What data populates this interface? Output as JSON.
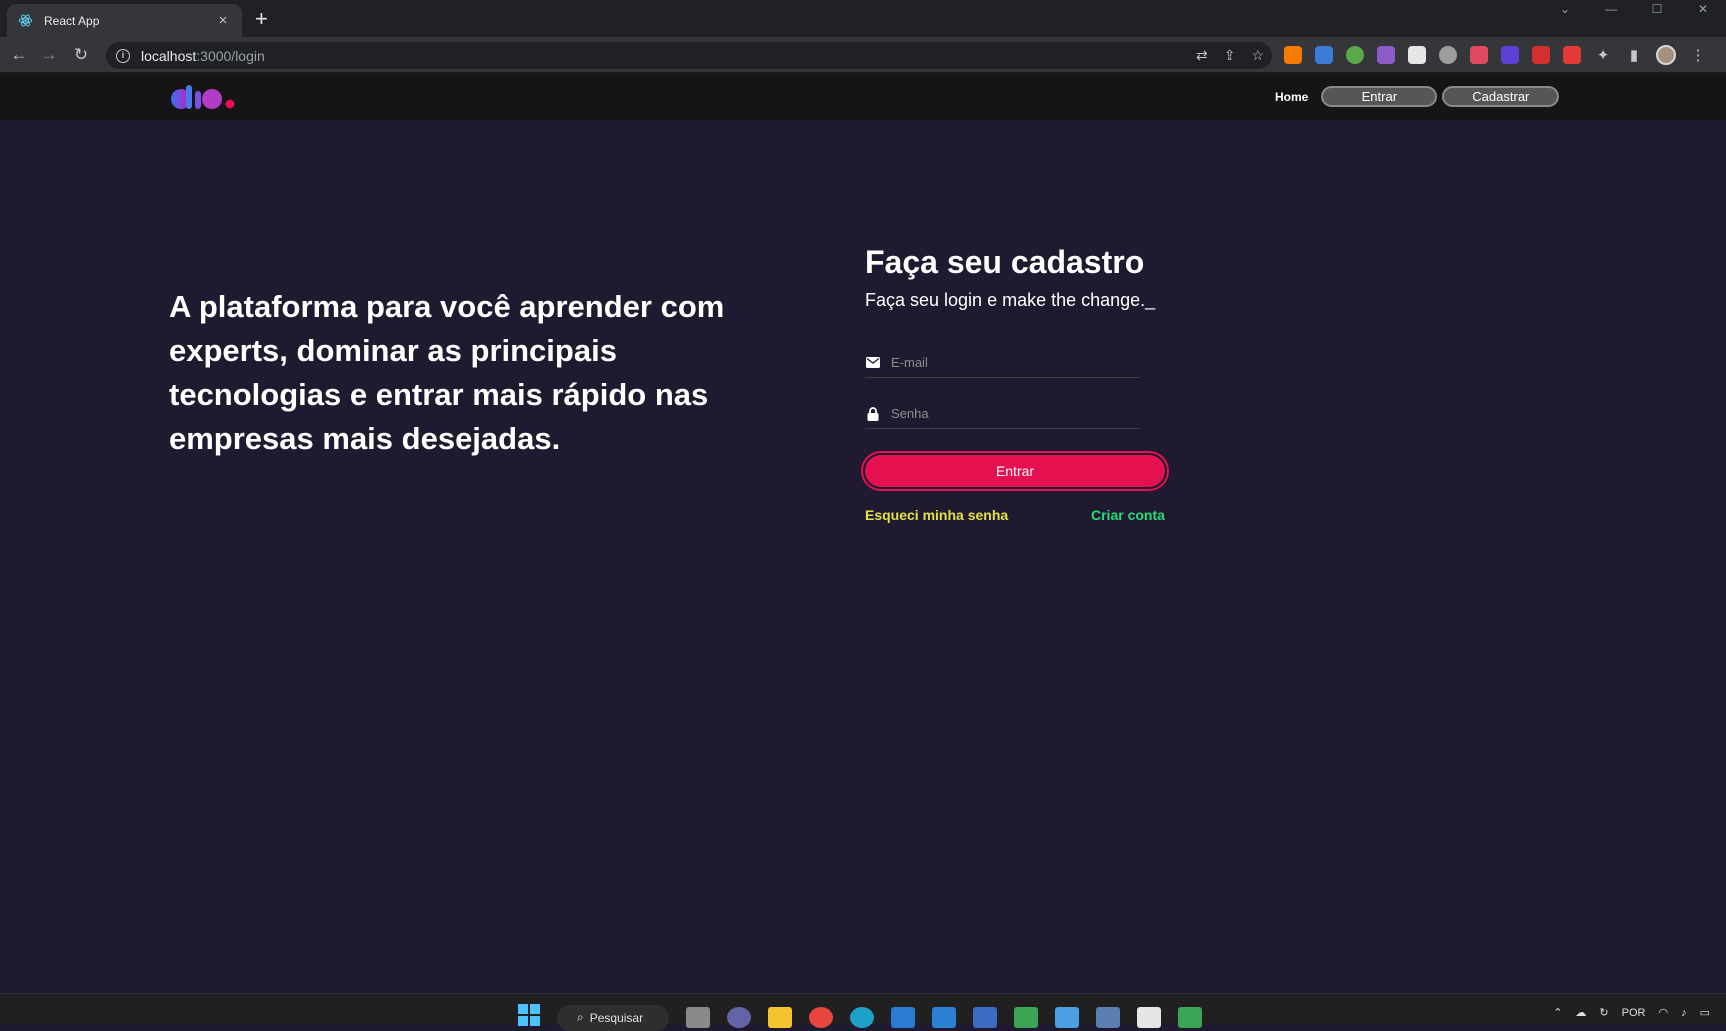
{
  "browser": {
    "tab_title": "React App",
    "tab_close": "×",
    "new_tab": "+",
    "url_host": "localhost",
    "url_path": ":3000/login",
    "window_controls": [
      "⌄",
      "—",
      "☐",
      "✕"
    ]
  },
  "header": {
    "logo_text": "dio",
    "nav_home": "Home",
    "nav_entrar": "Entrar",
    "nav_cadastrar": "Cadastrar"
  },
  "hero": {
    "text": "A plataforma para você aprender com experts, dominar as principais tecnologias e entrar mais rápido nas empresas mais desejadas."
  },
  "form": {
    "title": "Faça seu cadastro",
    "subtitle": "Faça seu login e make the change._",
    "email_placeholder": "E-mail",
    "password_placeholder": "Senha",
    "submit_label": "Entrar",
    "forgot_label": "Esqueci minha senha",
    "create_label": "Criar conta"
  },
  "taskbar": {
    "search_label": "Pesquisar",
    "lang": "POR"
  },
  "colors": {
    "page_bg": "#1f1a30",
    "header_bg": "#151515",
    "primary": "#e41050",
    "forgot": "#e5e044",
    "create": "#23dd7a"
  }
}
